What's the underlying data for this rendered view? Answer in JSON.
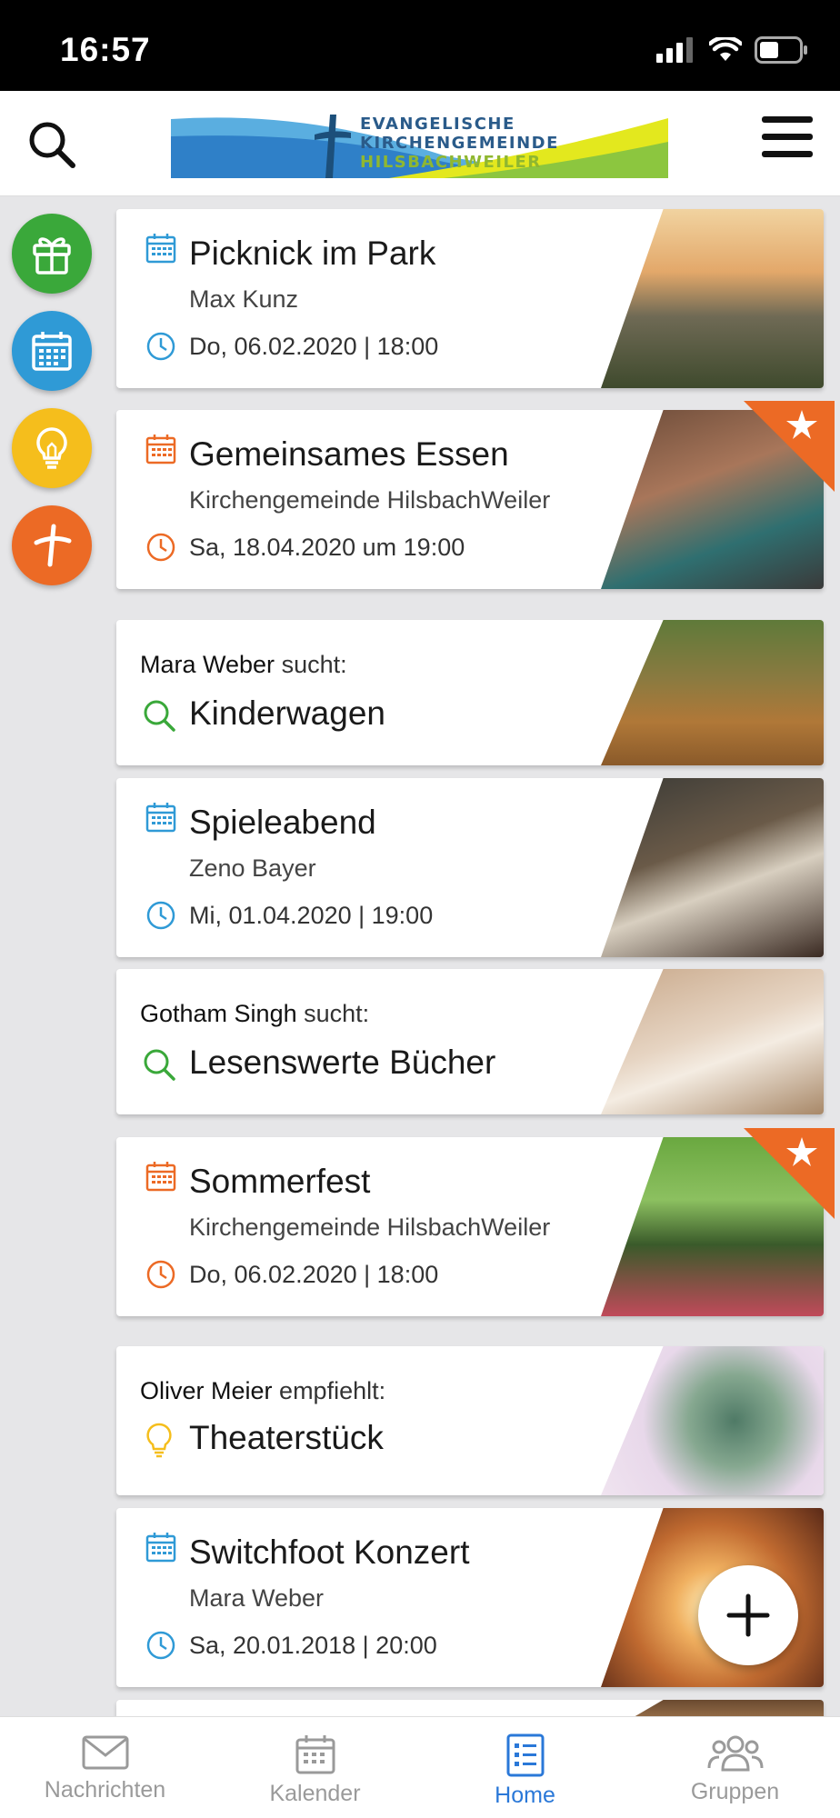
{
  "status": {
    "time": "16:57"
  },
  "header": {
    "logo_lines": [
      "EVANGELISCHE",
      "KIRCHENGEMEINDE",
      "HILSBACHWEILER"
    ]
  },
  "colors": {
    "green": "#3aa83a",
    "blue": "#2f9ad6",
    "yellow": "#f5be1c",
    "orange": "#ec6a25",
    "tab_active": "#2a78d8"
  },
  "side_actions": [
    {
      "name": "gift",
      "color": "#3aa83a"
    },
    {
      "name": "calendar",
      "color": "#2f9ad6"
    },
    {
      "name": "lightbulb",
      "color": "#f5be1c"
    },
    {
      "name": "cross",
      "color": "#ec6a25"
    }
  ],
  "feed": {
    "card1": {
      "title": "Picknick im Park",
      "subtitle": "Max Kunz",
      "date": "Do, 06.02.2020 | 18:00",
      "accent": "#2f9ad6"
    },
    "card2": {
      "title": "Gemeinsames Essen",
      "subtitle": "Kirchengemeinde HilsbachWeiler",
      "date": "Sa, 18.04.2020 um 19:00",
      "accent": "#ec6a25",
      "featured": true
    },
    "card3": {
      "person": "Mara Weber",
      "verb": "sucht:",
      "title": "Kinderwagen",
      "accent": "#3aa83a"
    },
    "card4": {
      "title": "Spieleabend",
      "subtitle": "Zeno Bayer",
      "date": "Mi, 01.04.2020 | 19:00",
      "accent": "#2f9ad6"
    },
    "card5": {
      "person": "Gotham Singh",
      "verb": "sucht:",
      "title": "Lesenswerte Bücher",
      "accent": "#3aa83a"
    },
    "card6": {
      "title": "Sommerfest",
      "subtitle": "Kirchengemeinde HilsbachWeiler",
      "date": "Do, 06.02.2020 | 18:00",
      "accent": "#ec6a25",
      "featured": true
    },
    "card7": {
      "person": "Oliver Meier",
      "verb": "empfiehlt:",
      "title": "Theaterstück",
      "accent": "#f5be1c"
    },
    "card8": {
      "title": "Switchfoot Konzert",
      "subtitle": "Mara Weber",
      "date": "Sa, 20.01.2018 | 20:00",
      "accent": "#2f9ad6"
    }
  },
  "tabs": [
    {
      "label": "Nachrichten"
    },
    {
      "label": "Kalender"
    },
    {
      "label": "Home",
      "active": true
    },
    {
      "label": "Gruppen"
    }
  ]
}
